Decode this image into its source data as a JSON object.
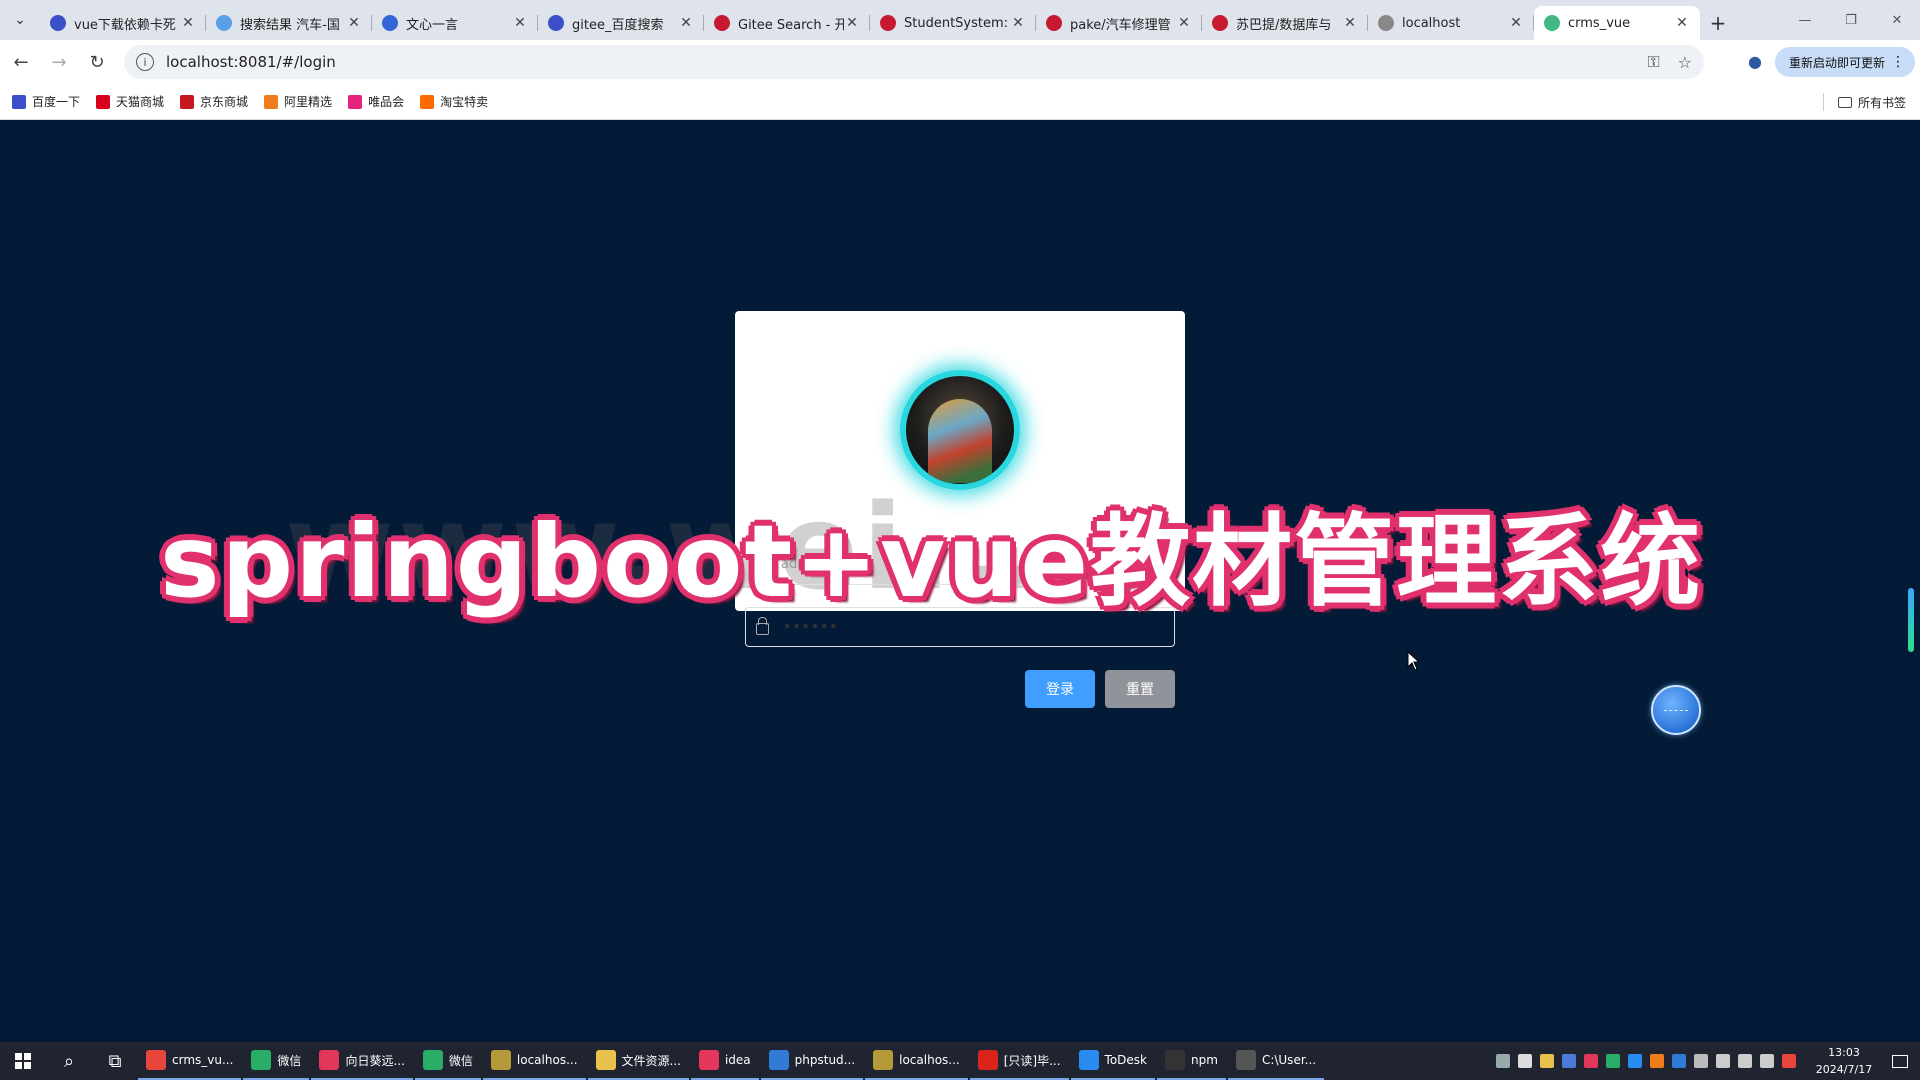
{
  "browser": {
    "tabs": [
      {
        "title": "vue下载依赖卡死",
        "icon": "baidu-paw-icon",
        "color": "#3b4fc8"
      },
      {
        "title": "搜索结果 汽车-国",
        "icon": "blue-square-icon",
        "color": "#5aa0e8"
      },
      {
        "title": "文心一言",
        "icon": "wenxin-icon",
        "color": "#3566d8"
      },
      {
        "title": "gitee_百度搜索",
        "icon": "baidu-paw-icon",
        "color": "#3b4fc8"
      },
      {
        "title": "Gitee Search - 开",
        "icon": "gitee-icon",
        "color": "#c7192f"
      },
      {
        "title": "StudentSystem:",
        "icon": "gitee-icon",
        "color": "#c7192f"
      },
      {
        "title": "pake/汽车修理管",
        "icon": "gitee-icon",
        "color": "#c7192f"
      },
      {
        "title": "苏巴提/数据库与",
        "icon": "gitee-icon",
        "color": "#c7192f"
      },
      {
        "title": "localhost",
        "icon": "globe-icon",
        "color": "#888888"
      },
      {
        "title": "crms_vue",
        "icon": "vue-icon",
        "color": "#41b883"
      }
    ],
    "active_tab_index": 9,
    "url": "localhost:8081/#/login",
    "update_label": "重新启动即可更新",
    "bookmarks": [
      {
        "label": "百度一下",
        "icon": "baidu-paw-icon",
        "color": "#3b4fc8"
      },
      {
        "label": "天猫商城",
        "icon": "tmall-icon",
        "color": "#d9001b"
      },
      {
        "label": "京东商城",
        "icon": "jd-icon",
        "color": "#c81623"
      },
      {
        "label": "阿里精选",
        "icon": "ali-icon",
        "color": "#f07c1b"
      },
      {
        "label": "唯品会",
        "icon": "vip-icon",
        "color": "#e5227e"
      },
      {
        "label": "淘宝特卖",
        "icon": "taobao-icon",
        "color": "#ff6a00"
      }
    ],
    "all_bookmarks_label": "所有书签"
  },
  "login": {
    "username_placeholder": "admin",
    "password_mask": "••••••",
    "login_button": "登录",
    "reset_button": "重置",
    "watermark_text": "www.wei..."
  },
  "overlay_title": "springboot+vue教材管理系统",
  "taskbar": {
    "apps": [
      {
        "label": "crms_vu...",
        "icon": "chrome-icon",
        "color": "#e8453c"
      },
      {
        "label": "微信",
        "icon": "wechat-icon",
        "color": "#2aae67"
      },
      {
        "label": "向日葵远...",
        "icon": "sunflower-icon",
        "color": "#e2375a"
      },
      {
        "label": "微信",
        "icon": "wechat-devtools-icon",
        "color": "#2aae67"
      },
      {
        "label": "localhos...",
        "icon": "server-icon",
        "color": "#b59a3a"
      },
      {
        "label": "文件资源...",
        "icon": "folder-icon",
        "color": "#e8c14a"
      },
      {
        "label": "idea",
        "icon": "idea-icon",
        "color": "#e2375a"
      },
      {
        "label": "phpstud...",
        "icon": "phpstudy-icon",
        "color": "#2f7bd6"
      },
      {
        "label": "localhos...",
        "icon": "server-icon",
        "color": "#b59a3a"
      },
      {
        "label": "[只读]毕...",
        "icon": "wps-icon",
        "color": "#d9231b"
      },
      {
        "label": "ToDesk",
        "icon": "todesk-icon",
        "color": "#2a8cf0"
      },
      {
        "label": "npm",
        "icon": "terminal-icon",
        "color": "#333333"
      },
      {
        "label": "C:\\User...",
        "icon": "cmd-icon",
        "color": "#555555"
      }
    ],
    "time": "13:03",
    "date": "2024/7/17"
  }
}
